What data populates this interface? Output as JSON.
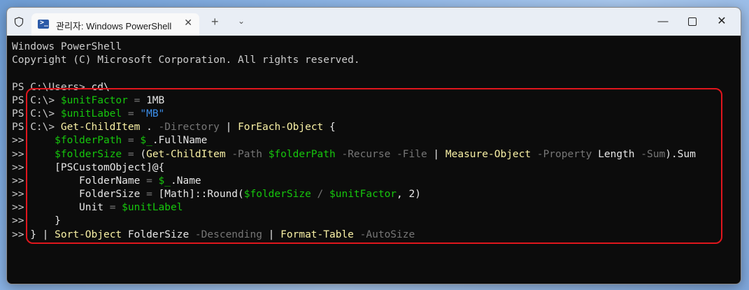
{
  "window": {
    "tab_title": "관리자: Windows PowerShell",
    "new_tab_label": "+",
    "dropdown_label": "⌄",
    "minimize_label": "—",
    "close_label": "✕"
  },
  "terminal": {
    "lines": [
      [
        {
          "t": "Windows PowerShell",
          "c": "plain"
        }
      ],
      [
        {
          "t": "Copyright (C) Microsoft Corporation. All rights reserved.",
          "c": "plain"
        }
      ],
      [
        {
          "t": "",
          "c": "plain"
        }
      ],
      [
        {
          "t": "PS C:\\Users> ",
          "c": "plain"
        },
        {
          "t": "cd\\",
          "c": "white"
        }
      ],
      [
        {
          "t": "PS C:\\> ",
          "c": "plain"
        },
        {
          "t": "$unitFactor",
          "c": "green"
        },
        {
          "t": " = ",
          "c": "gray"
        },
        {
          "t": "1MB",
          "c": "white"
        }
      ],
      [
        {
          "t": "PS C:\\> ",
          "c": "plain"
        },
        {
          "t": "$unitLabel",
          "c": "green"
        },
        {
          "t": " = ",
          "c": "gray"
        },
        {
          "t": "\"MB\"",
          "c": "blue"
        }
      ],
      [
        {
          "t": "PS C:\\> ",
          "c": "plain"
        },
        {
          "t": "Get-ChildItem",
          "c": "yellow"
        },
        {
          "t": " . ",
          "c": "white"
        },
        {
          "t": "-Directory",
          "c": "gray"
        },
        {
          "t": " | ",
          "c": "white"
        },
        {
          "t": "ForEach-Object",
          "c": "yellow"
        },
        {
          "t": " {",
          "c": "white"
        }
      ],
      [
        {
          "t": ">> ",
          "c": "plain"
        },
        {
          "t": "    $folderPath",
          "c": "green"
        },
        {
          "t": " = ",
          "c": "gray"
        },
        {
          "t": "$_",
          "c": "green"
        },
        {
          "t": ".FullName",
          "c": "white"
        }
      ],
      [
        {
          "t": ">> ",
          "c": "plain"
        },
        {
          "t": "    $folderSize",
          "c": "green"
        },
        {
          "t": " = ",
          "c": "gray"
        },
        {
          "t": "(",
          "c": "white"
        },
        {
          "t": "Get-ChildItem",
          "c": "yellow"
        },
        {
          "t": " -Path ",
          "c": "gray"
        },
        {
          "t": "$folderPath",
          "c": "green"
        },
        {
          "t": " -Recurse -File",
          "c": "gray"
        },
        {
          "t": " | ",
          "c": "white"
        },
        {
          "t": "Measure-Object",
          "c": "yellow"
        },
        {
          "t": " -Property ",
          "c": "gray"
        },
        {
          "t": "Length",
          "c": "white"
        },
        {
          "t": " -Sum",
          "c": "gray"
        },
        {
          "t": ").Sum",
          "c": "white"
        }
      ],
      [
        {
          "t": ">> ",
          "c": "plain"
        },
        {
          "t": "    [PSCustomObject]@{",
          "c": "white"
        }
      ],
      [
        {
          "t": ">> ",
          "c": "plain"
        },
        {
          "t": "        FolderName",
          "c": "white"
        },
        {
          "t": " = ",
          "c": "gray"
        },
        {
          "t": "$_",
          "c": "green"
        },
        {
          "t": ".Name",
          "c": "white"
        }
      ],
      [
        {
          "t": ">> ",
          "c": "plain"
        },
        {
          "t": "        FolderSize",
          "c": "white"
        },
        {
          "t": " = ",
          "c": "gray"
        },
        {
          "t": "[Math]::Round(",
          "c": "white"
        },
        {
          "t": "$folderSize",
          "c": "green"
        },
        {
          "t": " / ",
          "c": "gray"
        },
        {
          "t": "$unitFactor",
          "c": "green"
        },
        {
          "t": ", ",
          "c": "white"
        },
        {
          "t": "2",
          "c": "white"
        },
        {
          "t": ")",
          "c": "white"
        }
      ],
      [
        {
          "t": ">> ",
          "c": "plain"
        },
        {
          "t": "        Unit",
          "c": "white"
        },
        {
          "t": " = ",
          "c": "gray"
        },
        {
          "t": "$unitLabel",
          "c": "green"
        }
      ],
      [
        {
          "t": ">> ",
          "c": "plain"
        },
        {
          "t": "    }",
          "c": "white"
        }
      ],
      [
        {
          "t": ">> ",
          "c": "plain"
        },
        {
          "t": "} | ",
          "c": "white"
        },
        {
          "t": "Sort-Object",
          "c": "yellow"
        },
        {
          "t": " FolderSize ",
          "c": "white"
        },
        {
          "t": "-Descending",
          "c": "gray"
        },
        {
          "t": " | ",
          "c": "white"
        },
        {
          "t": "Format-Table",
          "c": "yellow"
        },
        {
          "t": " -AutoSize",
          "c": "gray"
        }
      ]
    ]
  },
  "colors": {
    "terminal_bg": "#0c0c0c",
    "highlight_border": "#e0161d",
    "command_yellow": "#f9f1a5",
    "variable_green": "#16c60c",
    "string_blue": "#3b8eea",
    "parameter_gray": "#767676"
  }
}
